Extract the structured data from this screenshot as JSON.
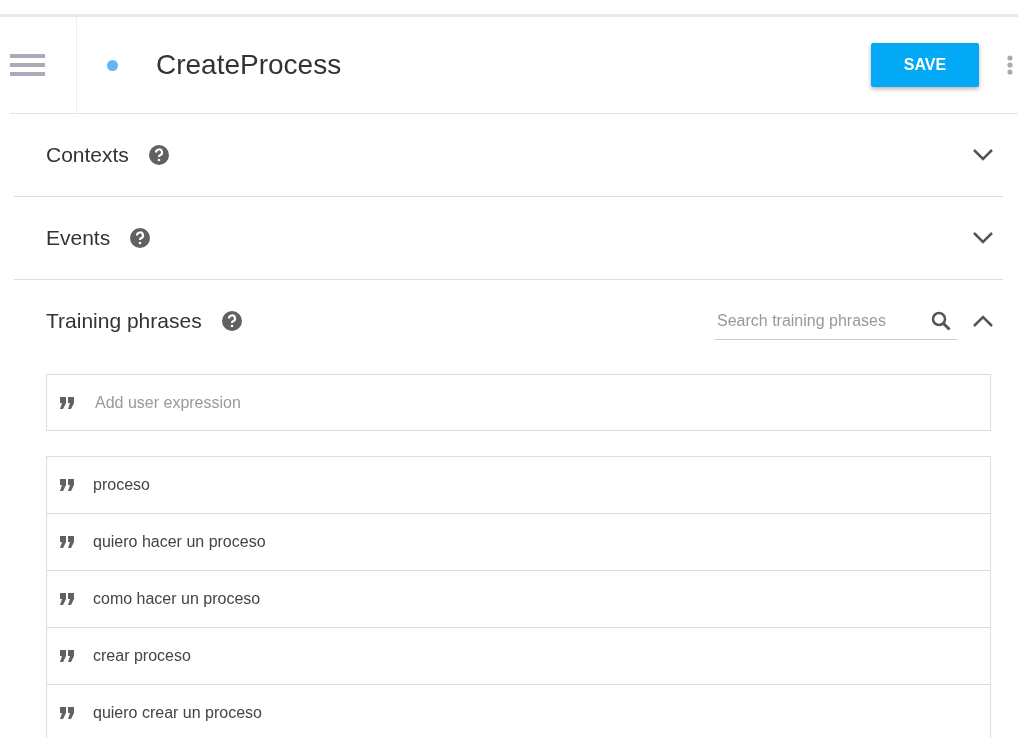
{
  "header": {
    "title": "CreateProcess",
    "save_label": "SAVE"
  },
  "sections": [
    {
      "title": "Contexts",
      "expanded": false
    },
    {
      "title": "Events",
      "expanded": false
    },
    {
      "title": "Training phrases",
      "expanded": true,
      "search": {
        "placeholder": "Search training phrases"
      },
      "add": {
        "placeholder": "Add user expression"
      },
      "phrases": [
        "proceso",
        "quiero hacer un proceso",
        "como hacer un proceso",
        "crear proceso",
        "quiero crear un proceso"
      ]
    }
  ]
}
